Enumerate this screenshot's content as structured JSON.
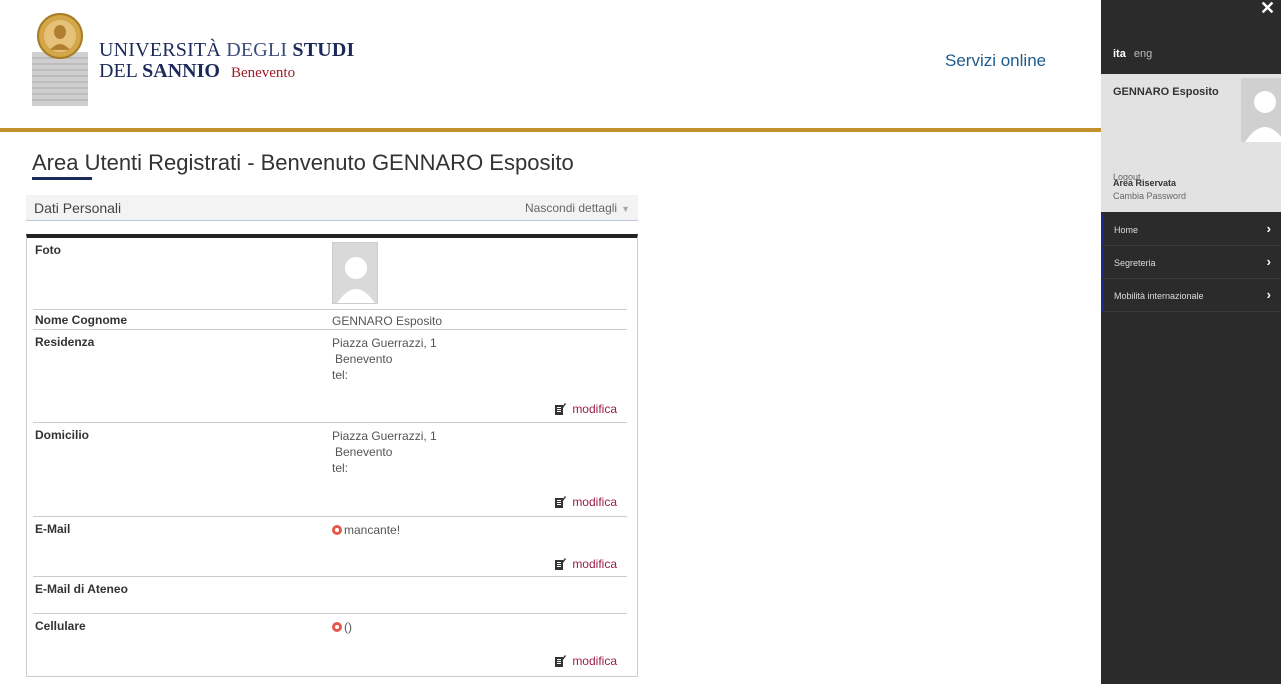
{
  "header": {
    "logo_line1_a": "UNIVERSITÀ",
    "logo_line1_b": "DEGLI",
    "logo_line1_c": "STUDI",
    "logo_line2_a": "DEL",
    "logo_line2_b": "SANNIO",
    "logo_line2_city": "Benevento",
    "servizi_label": "Servizi online"
  },
  "page": {
    "title": "Area Utenti Registrati - Benvenuto GENNARO Esposito"
  },
  "section": {
    "title": "Dati Personali",
    "toggle_label": "Nascondi dettagli",
    "toggle_arrow": "▼"
  },
  "rows": {
    "foto_label": "Foto",
    "nome_label": "Nome Cognome",
    "nome_value": "GENNARO Esposito",
    "residenza_label": "Residenza",
    "residenza_line1": "Piazza Guerrazzi, 1",
    "residenza_line2": "Benevento",
    "residenza_line3": "tel:",
    "domicilio_label": "Domicilio",
    "domicilio_line1": "Piazza Guerrazzi, 1",
    "domicilio_line2": "Benevento",
    "domicilio_line3": "tel:",
    "email_label": "E-Mail",
    "email_value": "mancante!",
    "email_ateneo_label": "E-Mail di Ateneo",
    "cellulare_label": "Cellulare",
    "cellulare_value": "()",
    "edit_label": "modifica"
  },
  "sidebar": {
    "close": "✕",
    "lang_active": "ita",
    "lang_other": "eng",
    "user_name": "GENNARO Esposito",
    "area_title": "Area Riservata",
    "logout": "Logout",
    "cambia_password": "Cambia Password",
    "nav": [
      "Home",
      "Segreteria",
      "Mobilità internazionale"
    ],
    "chevron": "›"
  },
  "colors": {
    "gold": "#c4922d",
    "navy": "#1b2a5a",
    "link": "#9c1c4a",
    "sidebar_bg": "#2b2b2b"
  }
}
